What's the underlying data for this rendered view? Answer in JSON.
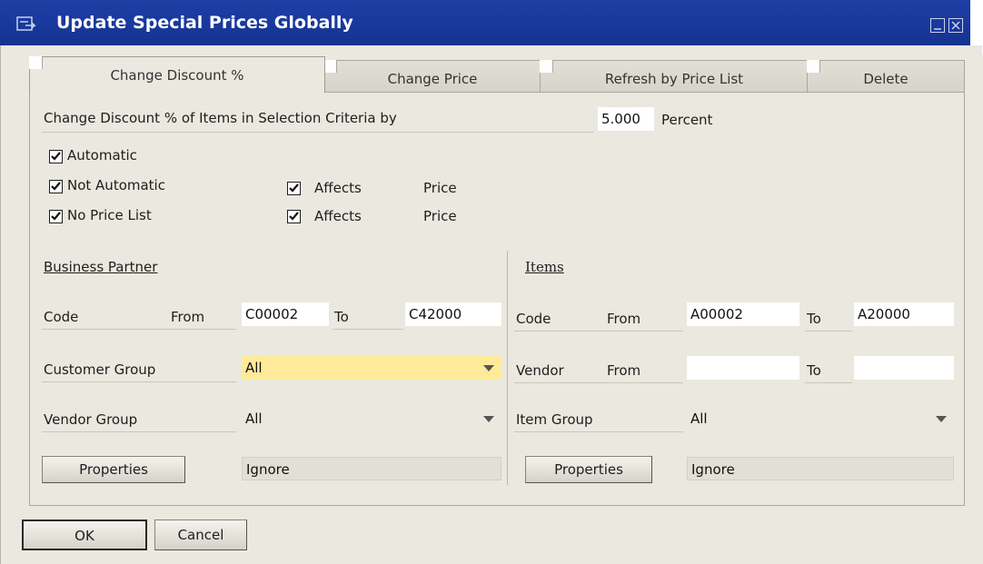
{
  "window": {
    "title": "Update Special Prices Globally",
    "icon": "form-icon"
  },
  "tabs": [
    {
      "label": "Change Discount %",
      "active": true
    },
    {
      "label": "Change Price",
      "active": false
    },
    {
      "label": "Refresh by Price List",
      "active": false
    },
    {
      "label": "Delete",
      "active": false
    }
  ],
  "discount": {
    "label": "Change Discount % of Items in Selection Criteria by",
    "value": "5.000",
    "unit": "Percent"
  },
  "checkboxes": {
    "automatic": {
      "label": "Automatic",
      "checked": true
    },
    "not_automatic": {
      "label": "Not Automatic",
      "checked": true
    },
    "no_price_list": {
      "label": "No Price List",
      "checked": true
    },
    "affects_1": {
      "label": "Affects",
      "suffix": "Price",
      "checked": true
    },
    "affects_2": {
      "label": "Affects",
      "suffix": "Price",
      "checked": true
    }
  },
  "business_partner": {
    "heading": "Business Partner",
    "code_label": "Code",
    "from_label": "From",
    "from_value": "C00002",
    "to_label": "To",
    "to_value": "C42000",
    "customer_group_label": "Customer Group",
    "customer_group_value": "All",
    "vendor_group_label": "Vendor Group",
    "vendor_group_value": "All",
    "properties_label": "Properties",
    "properties_value": "Ignore"
  },
  "items": {
    "heading": "Items",
    "code_label": "Code",
    "from_label": "From",
    "from_value": "A00002",
    "to_label": "To",
    "to_value": "A20000",
    "vendor_label": "Vendor",
    "vendor_from_label": "From",
    "vendor_from_value": "",
    "vendor_to_label": "To",
    "vendor_to_value": "",
    "item_group_label": "Item Group",
    "item_group_value": "All",
    "properties_label": "Properties",
    "properties_value": "Ignore"
  },
  "footer": {
    "ok_label": "OK",
    "cancel_label": "Cancel"
  },
  "colors": {
    "title_bar": "#1a3aa0",
    "background": "#eae8df",
    "highlight_field": "#fdeb9a"
  }
}
